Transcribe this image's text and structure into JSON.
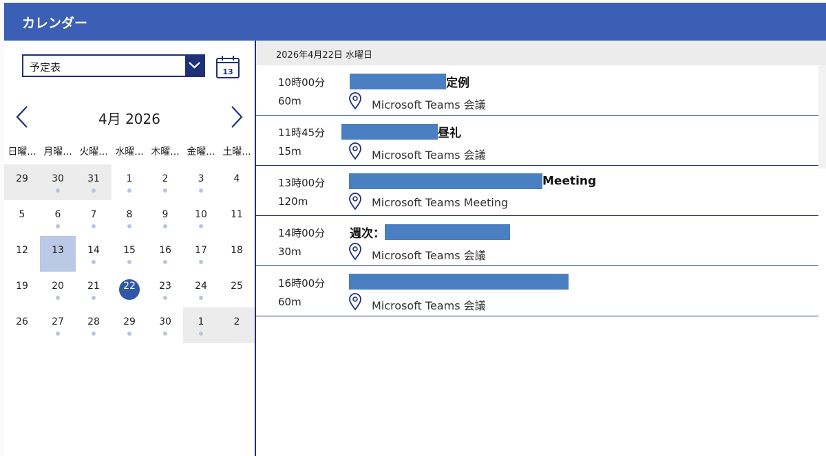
{
  "header": {
    "title": "カレンダー"
  },
  "calendar_select": {
    "value": "予定表"
  },
  "today_button": {
    "day": "13"
  },
  "month": {
    "label": "4月 2026"
  },
  "weekdays": [
    "日曜...",
    "月曜...",
    "火曜...",
    "水曜...",
    "木曜...",
    "金曜...",
    "土曜..."
  ],
  "weeks": [
    [
      {
        "d": "29",
        "outside": true,
        "dot": false
      },
      {
        "d": "30",
        "outside": true,
        "dot": true
      },
      {
        "d": "31",
        "outside": true,
        "dot": true
      },
      {
        "d": "1",
        "dot": true
      },
      {
        "d": "2",
        "dot": true
      },
      {
        "d": "3",
        "dot": true
      },
      {
        "d": "4",
        "dot": false
      }
    ],
    [
      {
        "d": "5",
        "dot": false
      },
      {
        "d": "6",
        "dot": true
      },
      {
        "d": "7",
        "dot": true
      },
      {
        "d": "8",
        "dot": true
      },
      {
        "d": "9",
        "dot": true
      },
      {
        "d": "10",
        "dot": true
      },
      {
        "d": "11",
        "dot": false
      }
    ],
    [
      {
        "d": "12",
        "dot": false
      },
      {
        "d": "13",
        "selected": true,
        "dot": false
      },
      {
        "d": "14",
        "dot": true
      },
      {
        "d": "15",
        "dot": true
      },
      {
        "d": "16",
        "dot": true
      },
      {
        "d": "17",
        "dot": true
      },
      {
        "d": "18",
        "dot": false
      }
    ],
    [
      {
        "d": "19",
        "dot": false
      },
      {
        "d": "20",
        "dot": true
      },
      {
        "d": "21",
        "dot": true
      },
      {
        "d": "22",
        "today": true,
        "dot": false
      },
      {
        "d": "23",
        "dot": true
      },
      {
        "d": "24",
        "dot": true
      },
      {
        "d": "25",
        "dot": false
      }
    ],
    [
      {
        "d": "26",
        "dot": false
      },
      {
        "d": "27",
        "dot": true
      },
      {
        "d": "28",
        "dot": true
      },
      {
        "d": "29",
        "dot": true
      },
      {
        "d": "30",
        "dot": true
      },
      {
        "d": "1",
        "outside": true,
        "dot": true
      },
      {
        "d": "2",
        "outside": true,
        "dot": false
      }
    ]
  ],
  "day_header": {
    "text": "2026年4月22日 水曜日"
  },
  "events": [
    {
      "time": "10時00分",
      "duration": "60m",
      "title_prefix": "",
      "title_suffix": "定例",
      "location": "Microsoft Teams 会議"
    },
    {
      "time": "11時45分",
      "duration": "15m",
      "title_prefix": "",
      "title_suffix": "昼礼",
      "location": "Microsoft Teams 会議"
    },
    {
      "time": "13時00分",
      "duration": "120m",
      "title_prefix": "",
      "title_suffix": "Meeting",
      "location": "Microsoft Teams Meeting"
    },
    {
      "time": "14時00分",
      "duration": "30m",
      "title_prefix": "週次：",
      "title_suffix": "",
      "location": "Microsoft Teams 会議"
    },
    {
      "time": "16時00分",
      "duration": "60m",
      "title_prefix": "",
      "title_suffix": "",
      "location": "Microsoft Teams 会議"
    }
  ],
  "colors": {
    "header": "#3a5fb4",
    "accent": "#1f2f78",
    "redaction": "#4a7fc1",
    "today": "#2f58a8",
    "selected": "#b9c9e6"
  }
}
